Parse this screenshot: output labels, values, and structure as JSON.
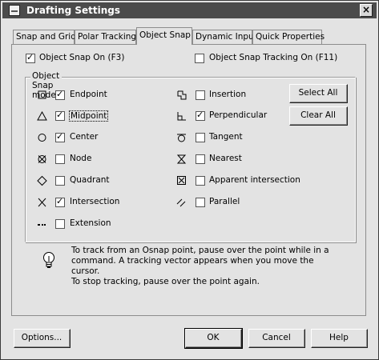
{
  "window": {
    "title": "Drafting Settings"
  },
  "tabs": [
    {
      "label": "Snap and Grid"
    },
    {
      "label": "Polar Tracking"
    },
    {
      "label": "Object Snap",
      "active": true
    },
    {
      "label": "Dynamic Input"
    },
    {
      "label": "Quick Properties"
    }
  ],
  "osnap_on": {
    "label": "Object Snap On (F3)",
    "checked": true
  },
  "osnap_tracking": {
    "label": "Object Snap Tracking On (F11)",
    "checked": false
  },
  "modes": {
    "title": "Object Snap modes",
    "left": [
      {
        "label": "Endpoint",
        "icon": "endpoint-square-icon",
        "checked": true
      },
      {
        "label": "Midpoint",
        "icon": "midpoint-triangle-icon",
        "checked": true
      },
      {
        "label": "Center",
        "icon": "center-circle-icon",
        "checked": true
      },
      {
        "label": "Node",
        "icon": "node-icon",
        "checked": false
      },
      {
        "label": "Quadrant",
        "icon": "quadrant-diamond-icon",
        "checked": false
      },
      {
        "label": "Intersection",
        "icon": "intersection-x-icon",
        "checked": true
      },
      {
        "label": "Extension",
        "icon": "extension-dots-icon",
        "checked": false
      }
    ],
    "right": [
      {
        "label": "Insertion",
        "icon": "insertion-icon",
        "checked": false
      },
      {
        "label": "Perpendicular",
        "icon": "perpendicular-icon",
        "checked": true
      },
      {
        "label": "Tangent",
        "icon": "tangent-icon",
        "checked": false
      },
      {
        "label": "Nearest",
        "icon": "nearest-hourglass-icon",
        "checked": false
      },
      {
        "label": "Apparent intersection",
        "icon": "apparent-intersection-icon",
        "checked": false
      },
      {
        "label": "Parallel",
        "icon": "parallel-icon",
        "checked": false
      }
    ],
    "select_all": "Select All",
    "clear_all": "Clear All"
  },
  "info": {
    "line1": "To track from an Osnap point, pause over the point while in a",
    "line2": "command.  A tracking vector appears when you move the cursor.",
    "line3": "To stop tracking, pause over the point again."
  },
  "footer": {
    "options": "Options...",
    "ok": "OK",
    "cancel": "Cancel",
    "help": "Help"
  }
}
